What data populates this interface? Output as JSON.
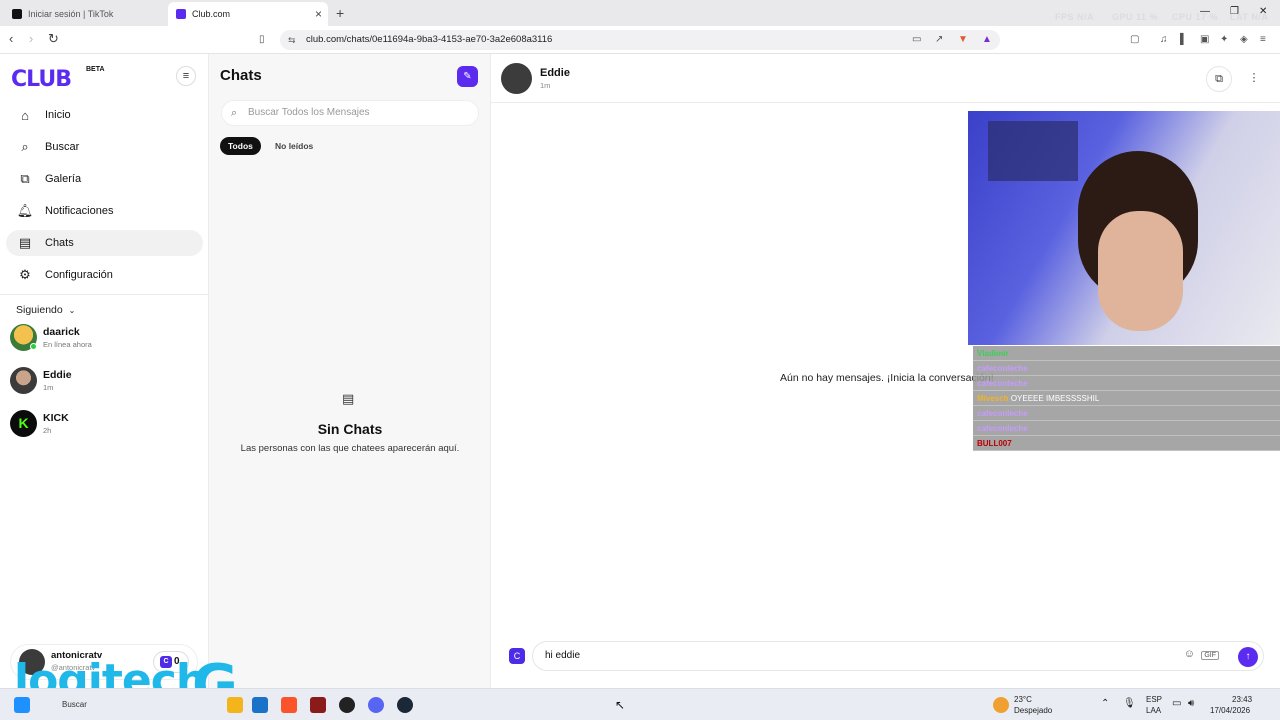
{
  "browser": {
    "tabs": [
      {
        "label": "Iniciar sesión | TikTok"
      },
      {
        "label": "Club.com"
      }
    ],
    "url": "club.com/chats/0e11694a-9ba3-4153-ae70-3a2e608a3116",
    "hud": {
      "fps": "FPS N/A",
      "gpu": "GPU 11 %",
      "cpu": "CPU 17 %",
      "lat": "LAT N/A"
    }
  },
  "sidebar": {
    "logo": "CLUB",
    "beta": "BETA",
    "items": [
      {
        "label": "Inicio",
        "icon": "home-icon"
      },
      {
        "label": "Buscar",
        "icon": "search-icon"
      },
      {
        "label": "Galería",
        "icon": "gallery-icon"
      },
      {
        "label": "Notificaciones",
        "icon": "bell-icon"
      },
      {
        "label": "Chats",
        "icon": "chat-icon"
      },
      {
        "label": "Configuración",
        "icon": "gear-icon"
      }
    ],
    "following_title": "Siguiendo",
    "following": [
      {
        "name": "daarick",
        "status": "En línea ahora"
      },
      {
        "name": "Eddie",
        "status": "1m"
      },
      {
        "name": "KICK",
        "status": "2h"
      }
    ],
    "user": {
      "name": "antonicratv",
      "handle": "@antonicratv",
      "coins": "0"
    }
  },
  "chats": {
    "title": "Chats",
    "search_placeholder": "Buscar Todos los Mensajes",
    "filters": [
      "Todos",
      "No leídos"
    ],
    "empty_title": "Sin Chats",
    "empty_sub": "Las personas con las que chatees aparecerán aquí."
  },
  "conversation": {
    "name": "Eddie",
    "time": "1m",
    "no_messages": "Aún no hay mensajes. ¡Inicia la conversación!",
    "draft": "hi eddie",
    "gif_label": "GIF"
  },
  "overlay_chat": [
    {
      "user": "Vladimir",
      "msg": ""
    },
    {
      "user": "cafeconleche",
      "msg": ""
    },
    {
      "user": "cafeconleche",
      "msg": ""
    },
    {
      "user": "Mivesch",
      "msg": "OYEEEE IMBESSSSHIL"
    },
    {
      "user": "cafeconleche",
      "msg": ""
    },
    {
      "user": "cafeconleche",
      "msg": ""
    },
    {
      "user": "BULL007",
      "msg": ""
    }
  ],
  "taskbar": {
    "search": "Buscar",
    "weather_temp": "23°C",
    "weather_desc": "Despejado",
    "lang": "ESP",
    "lang2": "LAA",
    "time": "23:43",
    "date": "17/04/2026"
  },
  "brand_overlay": "logitech",
  "colors": {
    "accent": "#5b2cf0",
    "online": "#2ecc40",
    "logitech": "#1fb8e8"
  }
}
